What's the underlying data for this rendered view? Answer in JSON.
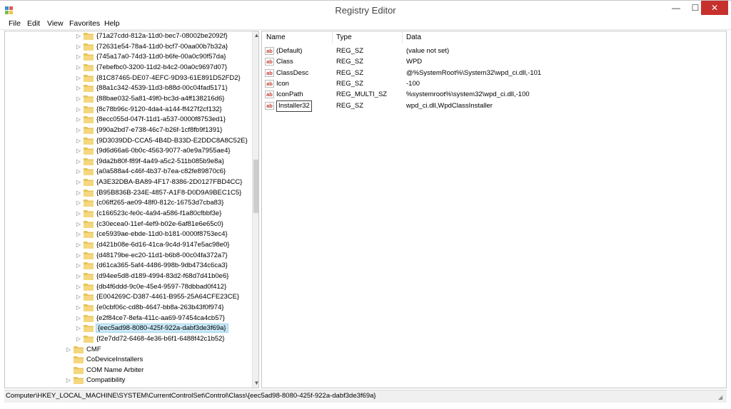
{
  "window": {
    "title": "Registry Editor",
    "controls": {
      "minimize": "—",
      "maximize": "☐",
      "close": "✕"
    }
  },
  "menu": [
    "File",
    "Edit",
    "View",
    "Favorites",
    "Help"
  ],
  "tree": {
    "guid_items": [
      "{71a27cdd-812a-11d0-bec7-08002be2092f}",
      "{72631e54-78a4-11d0-bcf7-00aa00b7b32a}",
      "{745a17a0-74d3-11d0-b6fe-00a0c90f57da}",
      "{7ebefbc0-3200-11d2-b4c2-00a0c9697d07}",
      "{81C87465-DE07-4EFC-9D93-61E891D52FD2}",
      "{88a1c342-4539-11d3-b88d-00c04fad5171}",
      "{88bae032-5a81-49f0-bc3d-a4ff138216d6}",
      "{8c78b96c-9120-4da4-a144-ff427f2cf132}",
      "{8ecc055d-047f-11d1-a537-0000f8753ed1}",
      "{990a2bd7-e738-46c7-b26f-1cf8fb9f1391}",
      "{9D3039DD-CCA5-4B4D-B33D-E2DDC8A8C52E}",
      "{9d6d66a6-0b0c-4563-9077-a0e9a7955ae4}",
      "{9da2b80f-f89f-4a49-a5c2-511b085b9e8a}",
      "{a0a588a4-c46f-4b37-b7ea-c82fe89870c6}",
      "{A3E32DBA-BA89-4F17-8386-2D0127FBD4CC}",
      "{B95B836B-234E-4857-A1F8-D0D9A9BEC1C5}",
      "{c06ff265-ae09-48f0-812c-16753d7cba83}",
      "{c166523c-fe0c-4a94-a586-f1a80cfbbf3e}",
      "{c30ecea0-11ef-4ef9-b02e-6af81e6e65c0}",
      "{ce5939ae-ebde-11d0-b181-0000f8753ec4}",
      "{d421b08e-6d16-41ca-9c4d-9147e5ac98e0}",
      "{d48179be-ec20-11d1-b6b8-00c04fa372a7}",
      "{d61ca365-5af4-4486-998b-9db4734c6ca3}",
      "{d94ee5d8-d189-4994-83d2-f68d7d41b0e6}",
      "{db4f6ddd-9c0e-45e4-9597-78dbbad0f412}",
      "{E004269C-D387-4461-B955-25A64CFE23CE}",
      "{e0cbf06c-cd8b-4647-bb8a-263b43f0f974}",
      "{e2f84ce7-8efa-411c-aa69-97454ca4cb57}",
      "{eec5ad98-8080-425f-922a-dabf3de3f69a}",
      "{f2e7dd72-6468-4e36-b6f1-6488f42c1b52}"
    ],
    "selected_item": "{eec5ad98-8080-425f-922a-dabf3de3f69a}",
    "parent_items": [
      {
        "label": "CMF",
        "expandable": true
      },
      {
        "label": "CoDeviceInstallers",
        "expandable": false
      },
      {
        "label": "COM Name Arbiter",
        "expandable": false
      },
      {
        "label": "Compatibility",
        "expandable": true
      }
    ]
  },
  "values_pane": {
    "columns": {
      "name": "Name",
      "type": "Type",
      "data": "Data"
    },
    "rows": [
      {
        "name": "(Default)",
        "type": "REG_SZ",
        "data": "(value not set)"
      },
      {
        "name": "Class",
        "type": "REG_SZ",
        "data": "WPD"
      },
      {
        "name": "ClassDesc",
        "type": "REG_SZ",
        "data": "@%SystemRoot%\\System32\\wpd_ci.dll,-101"
      },
      {
        "name": "Icon",
        "type": "REG_SZ",
        "data": "-100"
      },
      {
        "name": "IconPath",
        "type": "REG_MULTI_SZ",
        "data": "%systemroot%\\system32\\wpd_ci.dll,-100"
      },
      {
        "name": "Installer32",
        "type": "REG_SZ",
        "data": "wpd_ci.dll,WpdClassInstaller"
      }
    ],
    "editing_row": "Installer32"
  },
  "status_bar": {
    "path": "Computer\\HKEY_LOCAL_MACHINE\\SYSTEM\\CurrentControlSet\\Control\\Class\\{eec5ad98-8080-425f-922a-dabf3de3f69a}"
  },
  "colors": {
    "close_button": "#c7312d",
    "selection": "#cbe8f6",
    "folder": "#e8c35a"
  },
  "icons": {
    "app": "registry-editor-icon",
    "tree_folder": "folder-icon",
    "expander": "triangle-right-icon",
    "value": "string-value-icon"
  }
}
